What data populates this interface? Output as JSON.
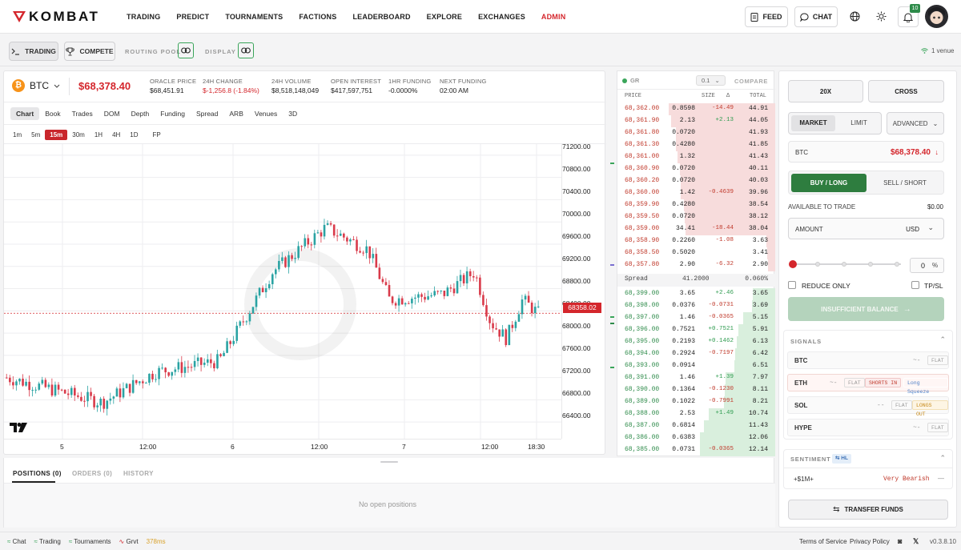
{
  "brand": {
    "name": "KOMBAT"
  },
  "nav": {
    "links": [
      "TRADING",
      "PREDICT",
      "TOURNAMENTS",
      "FACTIONS",
      "LEADERBOARD",
      "EXPLORE",
      "EXCHANGES",
      "ADMIN"
    ],
    "feed": "FEED",
    "chat": "CHAT",
    "notif_count": "10"
  },
  "subbar": {
    "trading": "TRADING",
    "compete": "COMPETE",
    "routing_pool": "ROUTING POOL",
    "display": "DISPLAY",
    "venue": "1 venue"
  },
  "ticker": {
    "symbol": "BTC",
    "price": "$68,378.40",
    "oracle_label": "ORACLE PRICE",
    "oracle": "$68,451.91",
    "change_label": "24H CHANGE",
    "change": "$-1,256.8 (-1.84%)",
    "volume_label": "24H VOLUME",
    "volume": "$8,518,148,049",
    "oi_label": "OPEN INTEREST",
    "oi": "$417,597,751",
    "funding_label": "1HR FUNDING",
    "funding": "-0.0000%",
    "next_label": "NEXT FUNDING",
    "next": "02:00 AM"
  },
  "chart_tabs": [
    "Chart",
    "Book",
    "Trades",
    "DOM",
    "Depth",
    "Funding",
    "Spread",
    "ARB",
    "Venues",
    "3D"
  ],
  "timeframes": [
    "1m",
    "5m",
    "15m",
    "30m",
    "1H",
    "4H",
    "1D",
    "FP"
  ],
  "chart": {
    "y_ticks": [
      "71200.00",
      "70800.00",
      "70400.00",
      "70000.00",
      "69600.00",
      "69200.00",
      "68800.00",
      "68400.00",
      "68000.00",
      "67600.00",
      "67200.00",
      "66800.00",
      "66400.00"
    ],
    "x_ticks": [
      "5",
      "12:00",
      "6",
      "12:00",
      "7",
      "12:00",
      "18:30"
    ],
    "last_price": "68358.02"
  },
  "chart_data": {
    "type": "candlestick",
    "y_range": [
      66100,
      71400
    ],
    "last": 68358.02,
    "key_points": [
      [
        0,
        67200
      ],
      [
        0.18,
        66750
      ],
      [
        0.28,
        67300
      ],
      [
        0.4,
        67500
      ],
      [
        0.5,
        69100
      ],
      [
        0.6,
        69900
      ],
      [
        0.68,
        69500
      ],
      [
        0.72,
        68600
      ],
      [
        0.82,
        68700
      ],
      [
        0.88,
        69100
      ],
      [
        0.91,
        68200
      ],
      [
        0.94,
        67900
      ],
      [
        0.97,
        68600
      ],
      [
        1,
        68358
      ]
    ]
  },
  "orderbook": {
    "sig": "GR",
    "step": "0.1",
    "compare": "COMPARE",
    "headers": [
      "PRICE",
      "SIZE",
      "Δ",
      "TOTAL"
    ],
    "asks": [
      [
        "68,362.00",
        "0.8598",
        "-14.49",
        "44.91"
      ],
      [
        "68,361.90",
        "2.13",
        "+2.13",
        "44.05"
      ],
      [
        "68,361.80",
        "0.0720",
        "",
        "41.93"
      ],
      [
        "68,361.30",
        "0.4280",
        "",
        "41.85"
      ],
      [
        "68,361.00",
        "1.32",
        "",
        "41.43"
      ],
      [
        "68,360.90",
        "0.0720",
        "",
        "40.11"
      ],
      [
        "68,360.20",
        "0.0720",
        "",
        "40.03"
      ],
      [
        "68,360.00",
        "1.42",
        "-0.4639",
        "39.96"
      ],
      [
        "68,359.90",
        "0.4280",
        "",
        "38.54"
      ],
      [
        "68,359.50",
        "0.0720",
        "",
        "38.12"
      ],
      [
        "68,359.00",
        "34.41",
        "-18.44",
        "38.04"
      ],
      [
        "68,358.90",
        "0.2260",
        "-1.08",
        "3.63"
      ],
      [
        "68,358.50",
        "0.5020",
        "",
        "3.41"
      ],
      [
        "68,357.80",
        "2.90",
        "-6.32",
        "2.90"
      ]
    ],
    "spread": {
      "label": "Spread",
      "value": "41.2000",
      "pct": "0.060%"
    },
    "bids": [
      [
        "68,399.00",
        "3.65",
        "+2.46",
        "3.65"
      ],
      [
        "68,398.00",
        "0.0376",
        "-0.0731",
        "3.69"
      ],
      [
        "68,397.00",
        "1.46",
        "-0.0365",
        "5.15"
      ],
      [
        "68,396.00",
        "0.7521",
        "+0.7521",
        "5.91"
      ],
      [
        "68,395.00",
        "0.2193",
        "+0.1462",
        "6.13"
      ],
      [
        "68,394.00",
        "0.2924",
        "-0.7197",
        "6.42"
      ],
      [
        "68,393.00",
        "0.0914",
        "",
        "6.51"
      ],
      [
        "68,391.00",
        "1.46",
        "+1.39",
        "7.97"
      ],
      [
        "68,390.00",
        "0.1364",
        "-0.1230",
        "8.11"
      ],
      [
        "68,389.00",
        "0.1022",
        "-0.7991",
        "8.21"
      ],
      [
        "68,388.00",
        "2.53",
        "+1.49",
        "10.74"
      ],
      [
        "68,387.00",
        "0.6814",
        "",
        "11.43"
      ],
      [
        "68,386.00",
        "0.6383",
        "",
        "12.06"
      ],
      [
        "68,385.00",
        "0.0731",
        "-0.0365",
        "12.14"
      ]
    ]
  },
  "positions": {
    "tabs": [
      "POSITIONS (0)",
      "ORDERS (0)",
      "HISTORY"
    ],
    "empty": "No open positions"
  },
  "order": {
    "leverage": "20X",
    "margin": "CROSS",
    "market": "MARKET",
    "limit": "LIMIT",
    "advanced": "ADVANCED",
    "symbol": "BTC",
    "price": "$68,378.40",
    "buy": "BUY / LONG",
    "sell": "SELL / SHORT",
    "available_label": "AVAILABLE TO TRADE",
    "available": "$0.00",
    "amount_label": "AMOUNT",
    "currency": "USD",
    "pct": "0",
    "pct_sym": "%",
    "reduce_only": "REDUCE ONLY",
    "tpsl": "TP/SL",
    "submit": "INSUFFICIENT BALANCE"
  },
  "signals": {
    "title": "SIGNALS",
    "rows": [
      {
        "sym": "BTC",
        "dash": "~-",
        "tags": [
          "FLAT"
        ]
      },
      {
        "sym": "ETH",
        "dash": "~-",
        "tags": [
          "FLAT",
          "SHORTS IN",
          "Long Squeeze"
        ]
      },
      {
        "sym": "SOL",
        "dash": "--",
        "tags": [
          "FLAT",
          "LONGS OUT"
        ]
      },
      {
        "sym": "HYPE",
        "dash": "~-",
        "tags": [
          "FLAT"
        ]
      }
    ]
  },
  "sentiment": {
    "title": "SENTIMENT",
    "badge": "HL",
    "row_label": "+$1M+",
    "row_value": "Very Bearish",
    "dash": "—"
  },
  "transfer": "TRANSFER FUNDS",
  "footer": {
    "chat": "Chat",
    "trading": "Trading",
    "tournaments": "Tournaments",
    "grvt": "Grvt",
    "latency": "378ms",
    "terms": "Terms of Service",
    "privacy": "Privacy Policy",
    "version": "v0.3.8.10"
  }
}
